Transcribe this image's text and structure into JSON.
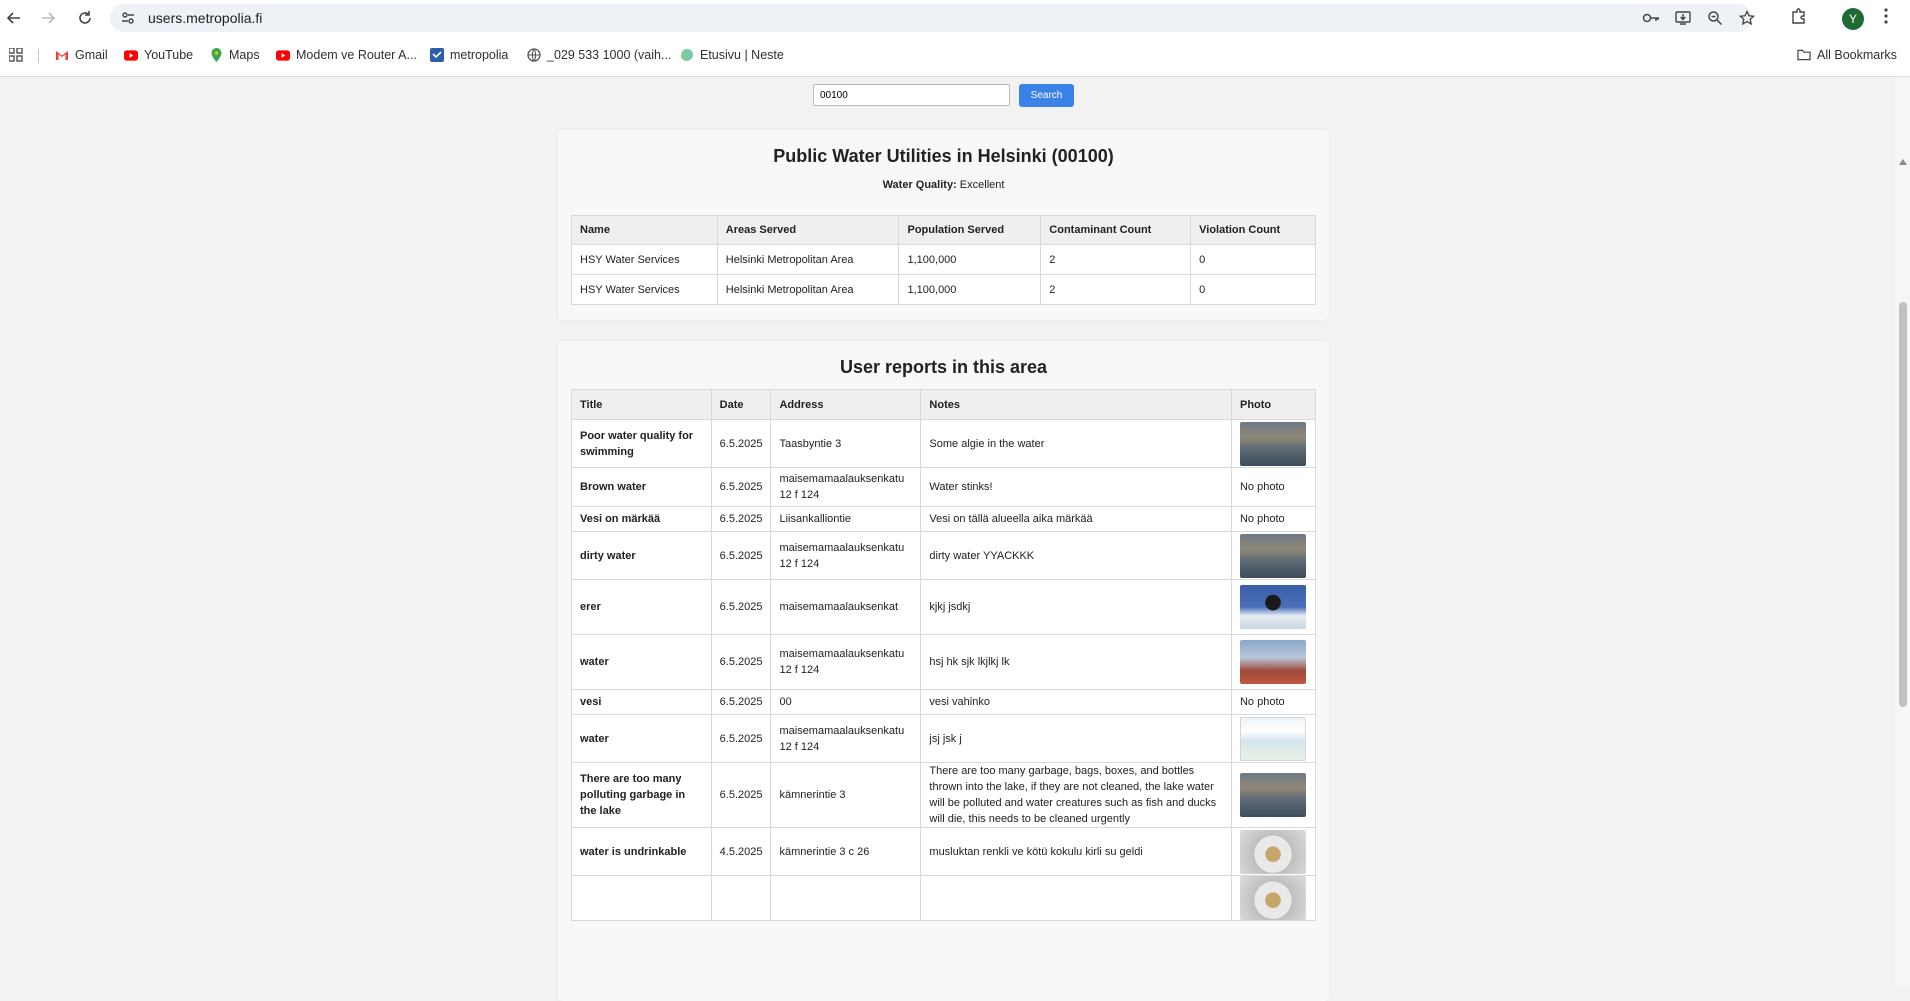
{
  "browser": {
    "url": "users.metropolia.fi",
    "avatar_letter": "Y",
    "bookmarks": [
      {
        "label": "Gmail",
        "icon": "gmail-icon"
      },
      {
        "label": "YouTube",
        "icon": "youtube-icon"
      },
      {
        "label": "Maps",
        "icon": "maps-icon"
      },
      {
        "label": "Modem ve Router A...",
        "icon": "youtube-icon"
      },
      {
        "label": "metropolia",
        "icon": "metropolia-icon"
      },
      {
        "label": "_029 533 1000 (vaih...",
        "icon": "globe-icon"
      },
      {
        "label": "Etusivu | Neste",
        "icon": "neste-icon"
      }
    ],
    "all_bookmarks": "All Bookmarks"
  },
  "search": {
    "value": "00100",
    "button": "Search"
  },
  "utilities": {
    "title": "Public Water Utilities in Helsinki (00100)",
    "quality_label": "Water Quality:",
    "quality_value": "Excellent",
    "headers": [
      "Name",
      "Areas Served",
      "Population Served",
      "Contaminant Count",
      "Violation Count"
    ],
    "rows": [
      [
        "HSY Water Services",
        "Helsinki Metropolitan Area",
        "1,100,000",
        "2",
        "0"
      ],
      [
        "HSY Water Services",
        "Helsinki Metropolitan Area",
        "1,100,000",
        "2",
        "0"
      ]
    ]
  },
  "reports": {
    "title": "User reports in this area",
    "headers": [
      "Title",
      "Date",
      "Address",
      "Notes",
      "Photo"
    ],
    "no_photo": "No photo",
    "rows": [
      {
        "title": "Poor water quality for swimming",
        "date": "6.5.2025",
        "address": "Taasbyntie 3",
        "notes": "Some algie in the water",
        "photo": "lake"
      },
      {
        "title": "Brown water",
        "date": "6.5.2025",
        "address": "maisemamaalauksenkatu 12 f 124",
        "notes": "Water stinks!",
        "photo": ""
      },
      {
        "title": "Vesi on märkää",
        "date": "6.5.2025",
        "address": "Liisankalliontie",
        "notes": "Vesi on tällä alueella aika märkää",
        "photo": ""
      },
      {
        "title": "dirty water",
        "date": "6.5.2025",
        "address": "maisemamaalauksenkatu 12 f 124",
        "notes": "dirty water YYACKKK",
        "photo": "lake"
      },
      {
        "title": "erer",
        "date": "6.5.2025",
        "address": "maisemamaalauksenkat",
        "notes": "kjkj jsdkj",
        "photo": "sculpt"
      },
      {
        "title": "water",
        "date": "6.5.2025",
        "address": "maisemamaalauksenkatu 12 f 124",
        "notes": "hsj hk sjk lkjlkj lk",
        "photo": "water"
      },
      {
        "title": "vesi",
        "date": "6.5.2025",
        "address": "00",
        "notes": "vesi vahinko",
        "photo": ""
      },
      {
        "title": "water",
        "date": "6.5.2025",
        "address": "maisemamaalauksenkatu 12 f 124",
        "notes": "jsj jsk j",
        "photo": "map"
      },
      {
        "title": "There are too many polluting garbage in the lake",
        "date": "6.5.2025",
        "address": "kämnerintie 3",
        "notes": "There are too many garbage, bags, boxes, and bottles thrown into the lake, if they are not cleaned, the lake water will be polluted and water creatures such as fish and ducks will die, this needs to be cleaned urgently",
        "photo": "lake"
      },
      {
        "title": "water is undrinkable",
        "date": "4.5.2025",
        "address": "kämnerintie 3 c 26",
        "notes": "musluktan renkli ve kötü kokulu kirli su geldi",
        "photo": "sink"
      },
      {
        "title": "",
        "date": "",
        "address": "",
        "notes": "",
        "photo": "sink"
      }
    ]
  }
}
